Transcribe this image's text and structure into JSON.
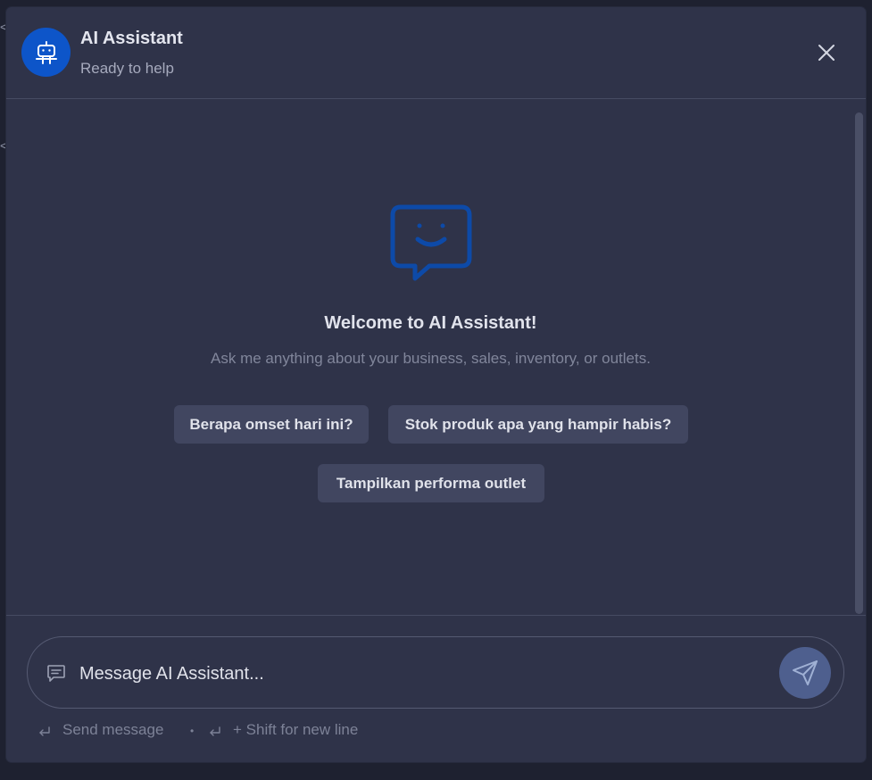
{
  "header": {
    "title": "AI Assistant",
    "subtitle": "Ready to help",
    "avatar_icon": "robot-icon",
    "close_icon": "close-icon"
  },
  "welcome": {
    "icon": "smiley-chat-icon",
    "title": "Welcome to AI Assistant!",
    "subtitle": "Ask me anything about your business, sales, inventory, or outlets."
  },
  "suggestions": [
    "Berapa omset hari ini?",
    "Stok produk apa yang hampir habis?",
    "Tampilkan performa outlet"
  ],
  "composer": {
    "placeholder": "Message AI Assistant...",
    "value": "",
    "send_icon": "send-icon",
    "message_icon": "message-icon"
  },
  "hints": {
    "send": "Send message",
    "separator": "•",
    "newline": "+ Shift for new line"
  },
  "colors": {
    "panel_bg": "#2f3349",
    "accent_blue": "#0d55c9",
    "chip_bg": "#414660",
    "send_bg": "#4e5f8e"
  }
}
